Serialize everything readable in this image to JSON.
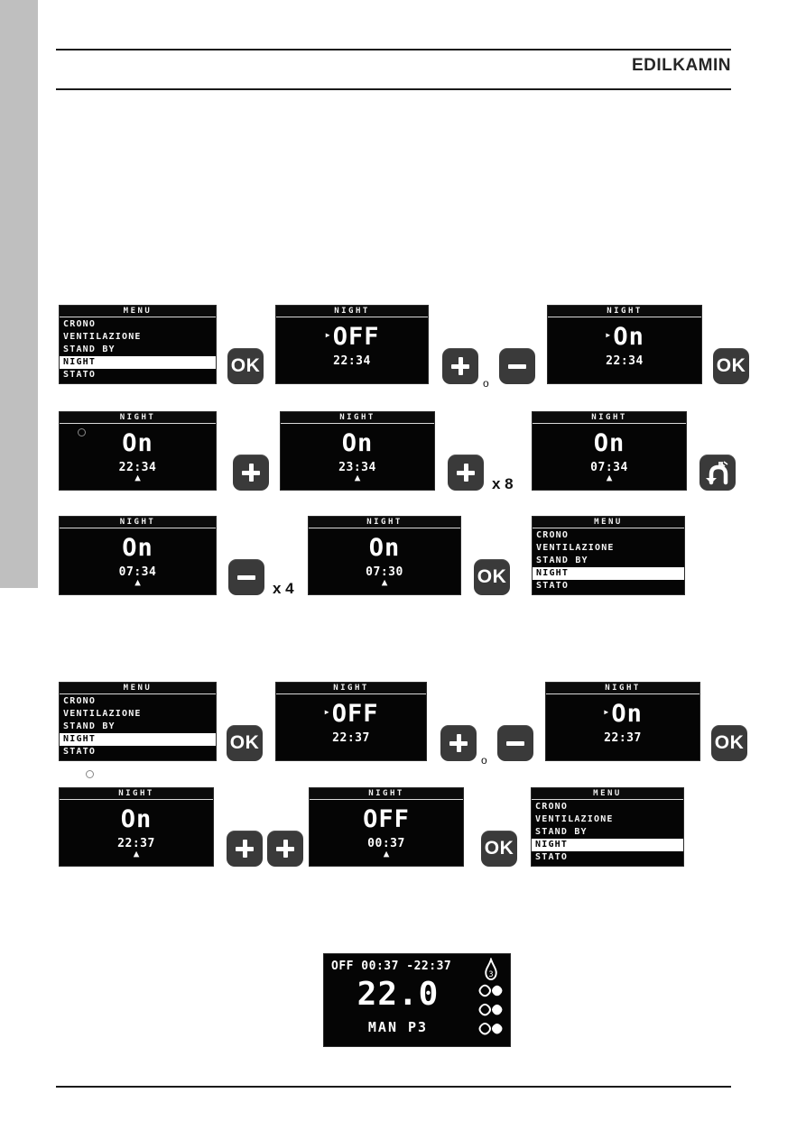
{
  "header": {
    "brand_prefix": "EDIL",
    "brand_k": "K",
    "brand_suffix": "AMIN",
    "brand_full": "EDILKAMIN"
  },
  "menu_screen": {
    "title": "MENU",
    "items": [
      "CRONO",
      "VENTILAZIONE",
      "STAND BY",
      "NIGHT",
      "STATO"
    ],
    "selected": "NIGHT"
  },
  "buttons": {
    "ok": "OK",
    "plus": "+",
    "minus": "−",
    "back": "back-arrow",
    "or": "o"
  },
  "section1": {
    "step1": {
      "panel": {
        "type": "menu"
      },
      "button": "OK"
    },
    "step2": {
      "title": "NIGHT",
      "value": "OFF",
      "time": "22:34",
      "caret": "▸",
      "or_label": "o"
    },
    "step3": {
      "title": "NIGHT",
      "value": "On",
      "time": "22:34",
      "caret": "▸",
      "button": "OK"
    },
    "step4": {
      "title": "NIGHT",
      "value": "On",
      "time": "22:34",
      "cursor": "▲"
    },
    "step5": {
      "title": "NIGHT",
      "value": "On",
      "time": "23:34",
      "cursor": "▲",
      "multiplier": "x 8"
    },
    "step6": {
      "title": "NIGHT",
      "value": "On",
      "time": "07:34",
      "cursor": "▲"
    },
    "step7": {
      "title": "NIGHT",
      "value": "On",
      "time": "07:34",
      "cursor": "▲",
      "multiplier": "x 4"
    },
    "step8": {
      "title": "NIGHT",
      "value": "On",
      "time": "07:30",
      "cursor": "▲",
      "button": "OK"
    },
    "step9": {
      "type": "menu"
    }
  },
  "section2": {
    "step1": {
      "type": "menu",
      "button": "OK"
    },
    "step2": {
      "title": "NIGHT",
      "value": "OFF",
      "time": "22:37",
      "caret": "▸",
      "or_label": "o"
    },
    "step3": {
      "title": "NIGHT",
      "value": "On",
      "time": "22:37",
      "caret": "▸",
      "button": "OK"
    },
    "step4": {
      "title": "NIGHT",
      "value": "On",
      "time": "22:37",
      "cursor": "▲"
    },
    "step5": {
      "title": "NIGHT",
      "value": "OFF",
      "time": "00:37",
      "cursor": "▲",
      "button": "OK"
    },
    "step6": {
      "type": "menu"
    }
  },
  "status_display": {
    "schedule": "OFF 00:37 -22:37",
    "temperature": "22.0",
    "mode": "MAN",
    "power": "P3",
    "mode_line": "MAN  P3",
    "icons": [
      "flame-icon",
      "fan-icon",
      "fan-icon",
      "fan-icon"
    ]
  },
  "colors": {
    "lcd_background": "#050505",
    "lcd_text": "#ffffff",
    "button_body": "#3a3a3a",
    "side_tab": "#bfbfbf",
    "rule": "#1a1a1a"
  }
}
